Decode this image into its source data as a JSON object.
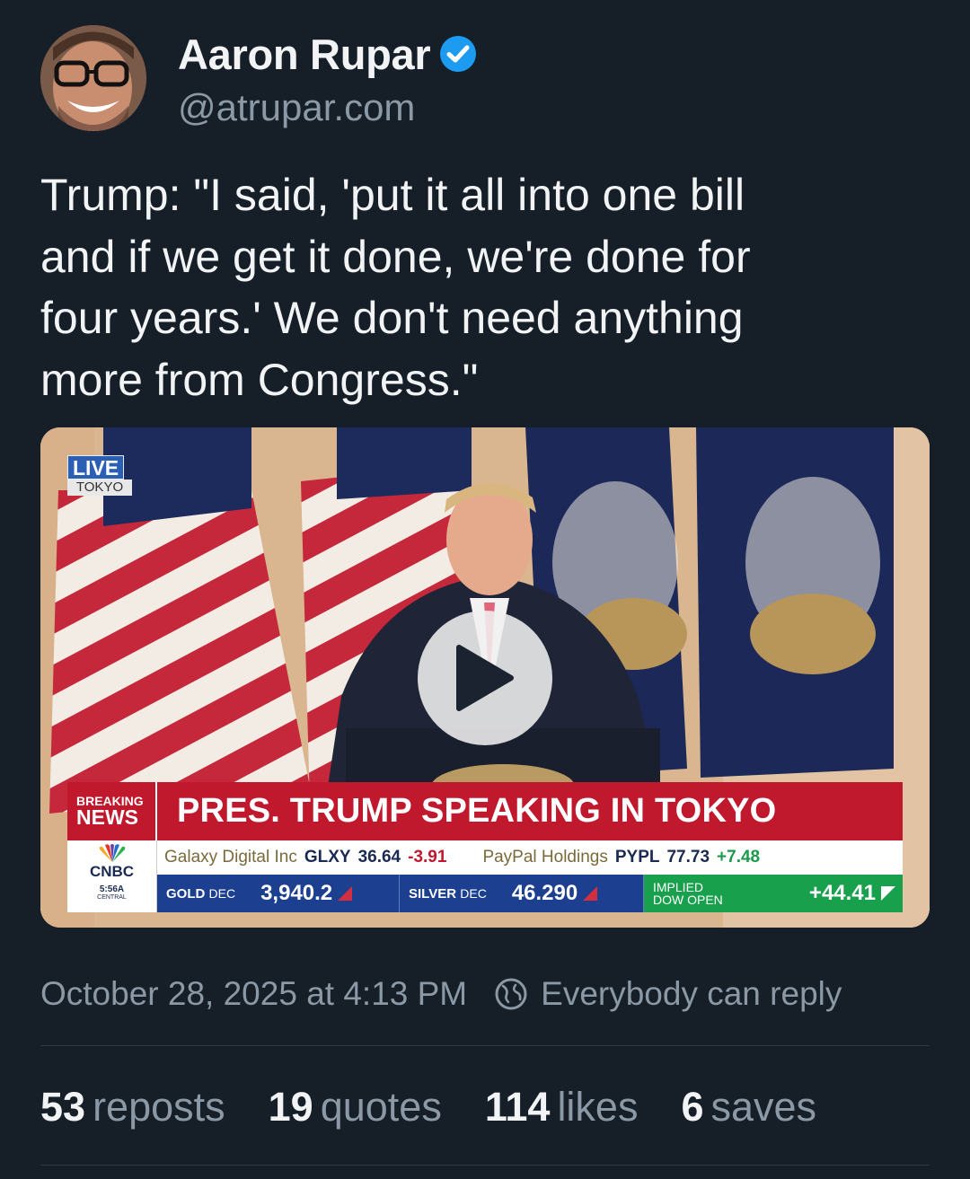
{
  "author": {
    "name": "Aaron Rupar",
    "handle": "@atrupar.com",
    "verified_icon": "verified-badge-icon",
    "accent_color": "#1d9bf0"
  },
  "post": {
    "text": "Trump: \"I said, 'put it all into one bill\nand if we get it done, we're done for\nfour years.' We don't need anything\nmore from Congress.\""
  },
  "video": {
    "play_icon": "play-icon",
    "live_badge": "LIVE",
    "live_location": "TOKYO",
    "breaking_line1": "BREAKING",
    "breaking_line2": "NEWS",
    "headline": "PRES. TRUMP SPEAKING IN TOKYO",
    "network": "CNBC",
    "time": "5:56A",
    "time_zone": "CENTRAL",
    "ticker_top": [
      {
        "name": "Galaxy Digital Inc",
        "symbol": "GLXY",
        "price": "36.64",
        "change": "-3.91"
      },
      {
        "name": "PayPal Holdings",
        "symbol": "PYPL",
        "price": "77.73",
        "change": "+7.48"
      }
    ],
    "gold_label": "GOLD",
    "gold_month": "DEC",
    "gold_value": "3,940.2",
    "silver_label": "SILVER",
    "silver_month": "DEC",
    "silver_value": "46.290",
    "dow_label_1": "IMPLIED",
    "dow_label_2": "DOW OPEN",
    "dow_value": "+44.41"
  },
  "meta": {
    "timestamp": "October 28, 2025 at 4:13 PM",
    "reply_setting": "Everybody can reply",
    "reply_icon": "globe-icon"
  },
  "stats": {
    "reposts_count": "53",
    "reposts_label": "reposts",
    "quotes_count": "19",
    "quotes_label": "quotes",
    "likes_count": "114",
    "likes_label": "likes",
    "saves_count": "6",
    "saves_label": "saves"
  }
}
